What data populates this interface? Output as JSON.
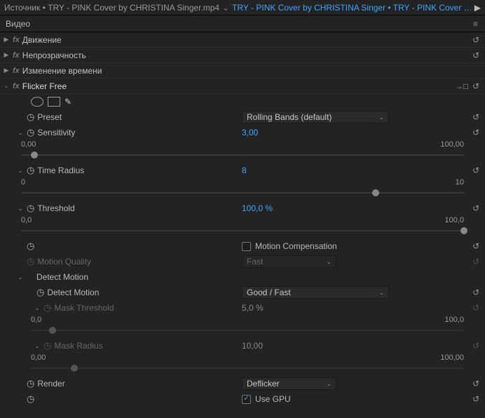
{
  "header": {
    "source_prefix": "Источник",
    "source_file": "TRY - PINK Cover by  CHRISTINA Singer.mp4",
    "tab_active": "TRY - PINK Cover by  CHRISTINA Singer • TRY - PINK Cover by  CHR..."
  },
  "category": "Видео",
  "effects": {
    "motion": "Движение",
    "opacity": "Непрозрачность",
    "time_remap": "Изменение времени",
    "flicker_free": "Flicker Free"
  },
  "params": {
    "preset": {
      "label": "Preset",
      "value": "Rolling Bands (default)"
    },
    "sensitivity": {
      "label": "Sensitivity",
      "value": "3,00",
      "min": "0,00",
      "max": "100,00",
      "pos": 3
    },
    "time_radius": {
      "label": "Time Radius",
      "value": "8",
      "min": "0",
      "max": "10",
      "pos": 80
    },
    "threshold": {
      "label": "Threshold",
      "value": "100,0  %",
      "min": "0,0",
      "max": "100,0",
      "pos": 100
    },
    "motion_comp": {
      "label": "Motion Compensation",
      "checked": false
    },
    "motion_quality": {
      "label": "Motion Quality",
      "value": "Fast"
    },
    "detect_motion_group": "Detect Motion",
    "detect_motion": {
      "label": "Detect Motion",
      "value": "Good / Fast"
    },
    "mask_threshold": {
      "label": "Mask Threshold",
      "value": "5,0  %",
      "min": "0,0",
      "max": "100,0",
      "pos": 5
    },
    "mask_radius": {
      "label": "Mask Radius",
      "value": "10,00",
      "min": "0,00",
      "max": "100,00",
      "pos": 10
    },
    "render": {
      "label": "Render",
      "value": "Deflicker"
    },
    "use_gpu": {
      "label": "Use GPU",
      "checked": true
    }
  }
}
